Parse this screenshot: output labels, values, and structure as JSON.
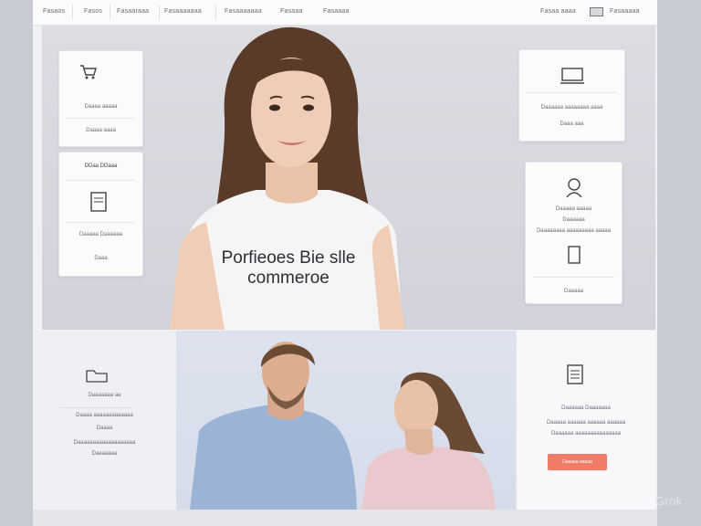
{
  "nav": {
    "items": [
      "Fasaos",
      "Fasos",
      "Fasaaraaa",
      "Fasaaaaaaa",
      "Fasaaaaaaa",
      "Fasaaa",
      "Fasaaaa"
    ],
    "right_link": "Fasaa aaaa",
    "right_link_2": "Fasaaaaa"
  },
  "hero": {
    "caption_line1": "Porfieoes Bie slle",
    "caption_line2": "commeroe"
  },
  "cards": {
    "left_top": {
      "icon": "shopping-cart-icon",
      "line1": "Daaaa aaaaa",
      "line2": "Daaaa aaaa"
    },
    "left_mid": {
      "title": "DDaa DDaaa",
      "icon": "document-icon",
      "line1": "Daaaaa Daaaaaa",
      "line2": "Daaa"
    },
    "right_top": {
      "icon": "laptop-icon",
      "line1": "Daaaaaa aaaaaaaa aaaa",
      "line2": "Daaa aaa"
    },
    "right_mid": {
      "icon": "person-icon",
      "line1": "Daaaaa aaaaa",
      "line2": "Daaaaaa",
      "line3": "Daaaaaaaa aaaaaaaaa aaaaa",
      "icon2": "tablet-icon",
      "line4": "Daaaaa"
    }
  },
  "lower_left": {
    "icon": "folder-icon",
    "line1": "Daaaaaaa aa",
    "line2": "Daaaa aaaaaaaaaaaaa",
    "line3": "Daaaa",
    "line4": "Daaaaaaaaaaaaaaaaaaa",
    "line5": "Daaaaaaa"
  },
  "lower_right": {
    "icon": "document-stack-icon",
    "line1": "Daaaaaa Daaaaaaa",
    "line2": "Daaaaa aaaaaa aaaaaa aaaaaa",
    "line3": "Daaaaaa aaaaaaaaaaaaaaa",
    "button": "Daaaaa aaaaa"
  },
  "watermark": "Grok",
  "colors": {
    "accent": "#f07b66",
    "background": "#f1f2f5"
  }
}
